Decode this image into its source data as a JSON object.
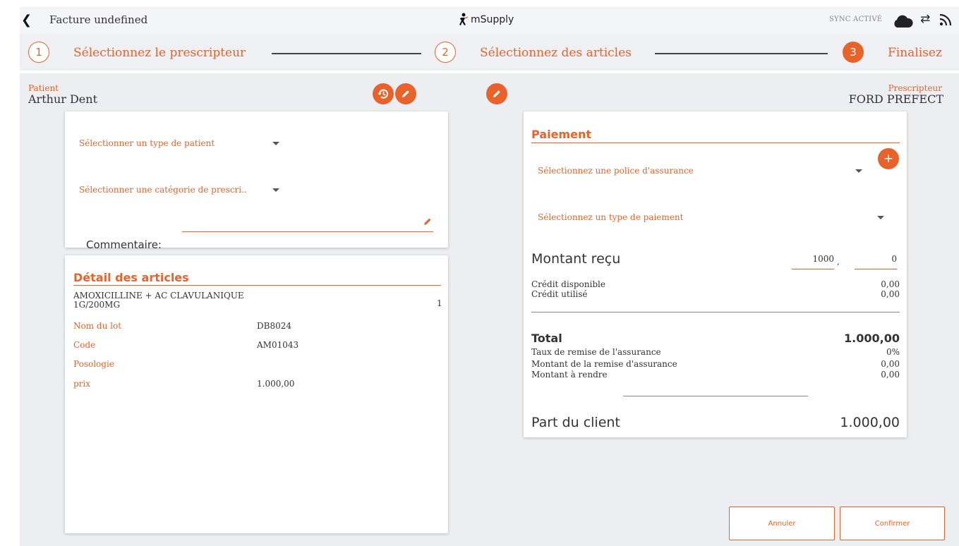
{
  "window": {
    "title": "Facture undefined",
    "logo": "mSupply",
    "sync_status": "SYNC ACTIVÉ"
  },
  "icons": {
    "back": "chevron-left-icon",
    "logo": "runner-logo-icon",
    "cloud": "cloud-icon",
    "sync": "swap-arrows-icon",
    "feed": "rss-icon"
  },
  "stepper": {
    "steps": [
      {
        "number": "1",
        "label": "Sélectionnez le prescripteur"
      },
      {
        "number": "2",
        "label": "Sélectionnez des articles"
      },
      {
        "number": "3",
        "label": "Finalisez"
      }
    ],
    "active_step": 3
  },
  "patient": {
    "label": "Patient",
    "name": "Arthur Dent"
  },
  "prescriber": {
    "label": "Prescripteur",
    "name": "FORD PREFECT"
  },
  "patient_card": {
    "patient_type_placeholder": "Sélectionner un type de patient",
    "prescription_category_placeholder": "Sélectionner une catégorie de prescri..",
    "comment_label": "Commentaire:",
    "comment_value": ""
  },
  "items_card": {
    "title": "Détail des articles",
    "item": {
      "name_line1": "AMOXICILLINE + AC CLAVULANIQUE",
      "name_line2": "1G/200MG",
      "quantity": "1",
      "fields": [
        {
          "label": "Nom du lot",
          "value": "DB8024"
        },
        {
          "label": "Code",
          "value": "AM01043"
        },
        {
          "label": "Posologie",
          "value": ""
        },
        {
          "label": "prix",
          "value": "1.000,00"
        }
      ]
    }
  },
  "payment_card": {
    "title": "Paiement",
    "insurance_placeholder": "Sélectionnez une police d'assurance",
    "payment_type_placeholder": "Sélectionnez un type de paiement",
    "amount_received_label": "Montant reçu",
    "amount_received_whole": "1000",
    "amount_received_separator": ",",
    "amount_received_decimal": "0",
    "credit_available_label": "Crédit disponible",
    "credit_available_value": "0,00",
    "credit_used_label": "Crédit utilisé",
    "credit_used_value": "0,00",
    "total_label": "Total",
    "total_value": "1.000,00",
    "insurance_discount_rate_label": "Taux de remise de l'assurance",
    "insurance_discount_rate_value": "0%",
    "insurance_discount_amount_label": "Montant de la remise d'assurance",
    "insurance_discount_amount_value": "0,00",
    "change_label": "Montant à rendre",
    "change_value": "0,00",
    "client_share_label": "Part du client",
    "client_share_value": "1.000,00"
  },
  "actions": {
    "cancel": "Annuler",
    "confirm": "Confirmer"
  },
  "colors": {
    "accent": "#e8632b",
    "background": "#eceef1",
    "card": "#ffffff"
  }
}
